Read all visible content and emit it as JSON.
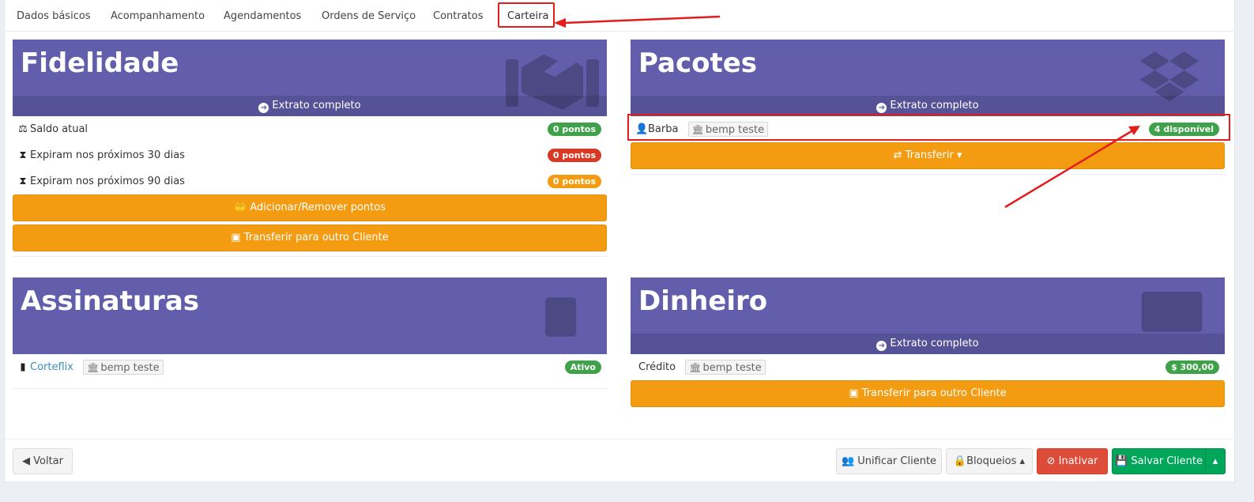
{
  "tabs": [
    {
      "label": "Dados básicos"
    },
    {
      "label": "Acompanhamento"
    },
    {
      "label": "Agendamentos"
    },
    {
      "label": "Ordens de Serviço"
    },
    {
      "label": "Contratos"
    },
    {
      "label": "Carteira"
    }
  ],
  "active_tab": "Carteira",
  "fidelidade": {
    "title": "Fidelidade",
    "footer_link": "Extrato completo",
    "rows": [
      {
        "label": "Saldo atual",
        "badge": "0 pontos",
        "badge_color": "#3fa24a"
      },
      {
        "label": "Expiram nos próximos 30 dias",
        "badge": "0 pontos",
        "badge_color": "#d73925"
      },
      {
        "label": "Expiram nos próximos 90 dias",
        "badge": "0 pontos",
        "badge_color": "#f39c12"
      }
    ],
    "add_remove_button": "Adicionar/Remover pontos",
    "transfer_button": "Transferir para outro Cliente"
  },
  "pacotes": {
    "title": "Pacotes",
    "footer_link": "Extrato completo",
    "item": {
      "name": "Barba",
      "tag": "bemp teste",
      "badge": "4 disponível"
    },
    "transfer_button": "Transferir"
  },
  "assinaturas": {
    "title": "Assinaturas",
    "item": {
      "name": "Corteflix",
      "tag": "bemp teste",
      "badge": "Ativo"
    }
  },
  "dinheiro": {
    "title": "Dinheiro",
    "footer_link": "Extrato completo",
    "item": {
      "name": "Crédito",
      "tag": "bemp teste",
      "badge": "$ 300,00"
    },
    "transfer_button": "Transferir para outro Cliente"
  },
  "actions": {
    "back": "Voltar",
    "merge": "Unificar Cliente",
    "locks": "Bloqueios",
    "deactivate": "Inativar",
    "save": "Salvar Cliente"
  },
  "colors": {
    "box_header": "#625eac",
    "orange_button": "#f39c12",
    "success": "#00a65a",
    "danger": "#dd4b39",
    "annotation": "#e31c1c"
  }
}
